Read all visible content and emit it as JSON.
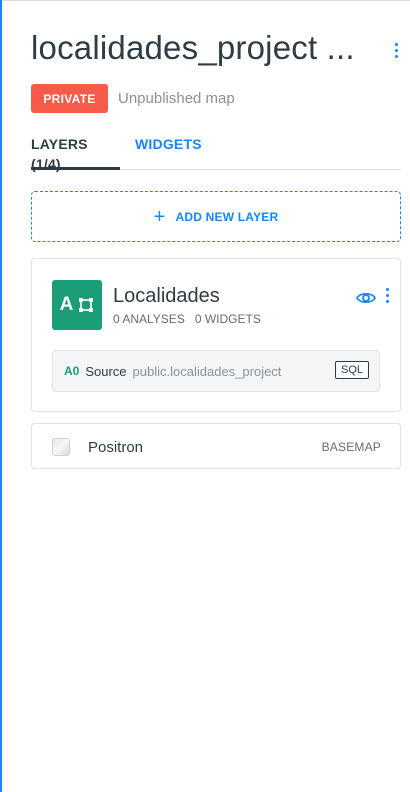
{
  "header": {
    "title": "localidades_project ...",
    "privacy_badge": "PRIVATE",
    "publish_status": "Unpublished map"
  },
  "tabs": [
    {
      "label": "LAYERS (1/4)",
      "active": true
    },
    {
      "label": "WIDGETS",
      "active": false
    }
  ],
  "add_layer": {
    "label": "ADD NEW LAYER",
    "icon": "plus-icon"
  },
  "layer": {
    "thumb_letter": "A",
    "thumb_icon": "polygon-nodes-icon",
    "name": "Localidades",
    "analyses": "0 ANALYSES",
    "widgets": "0 WIDGETS",
    "source": {
      "id": "A0",
      "label": "Source",
      "table": "public.localidades_project",
      "type_tag": "SQL"
    }
  },
  "basemap": {
    "name": "Positron",
    "tag": "BASEMAP"
  },
  "colors": {
    "accent": "#1785fb",
    "private": "#f65a48",
    "layer": "#1b9e77",
    "text": "#2e3c43"
  }
}
